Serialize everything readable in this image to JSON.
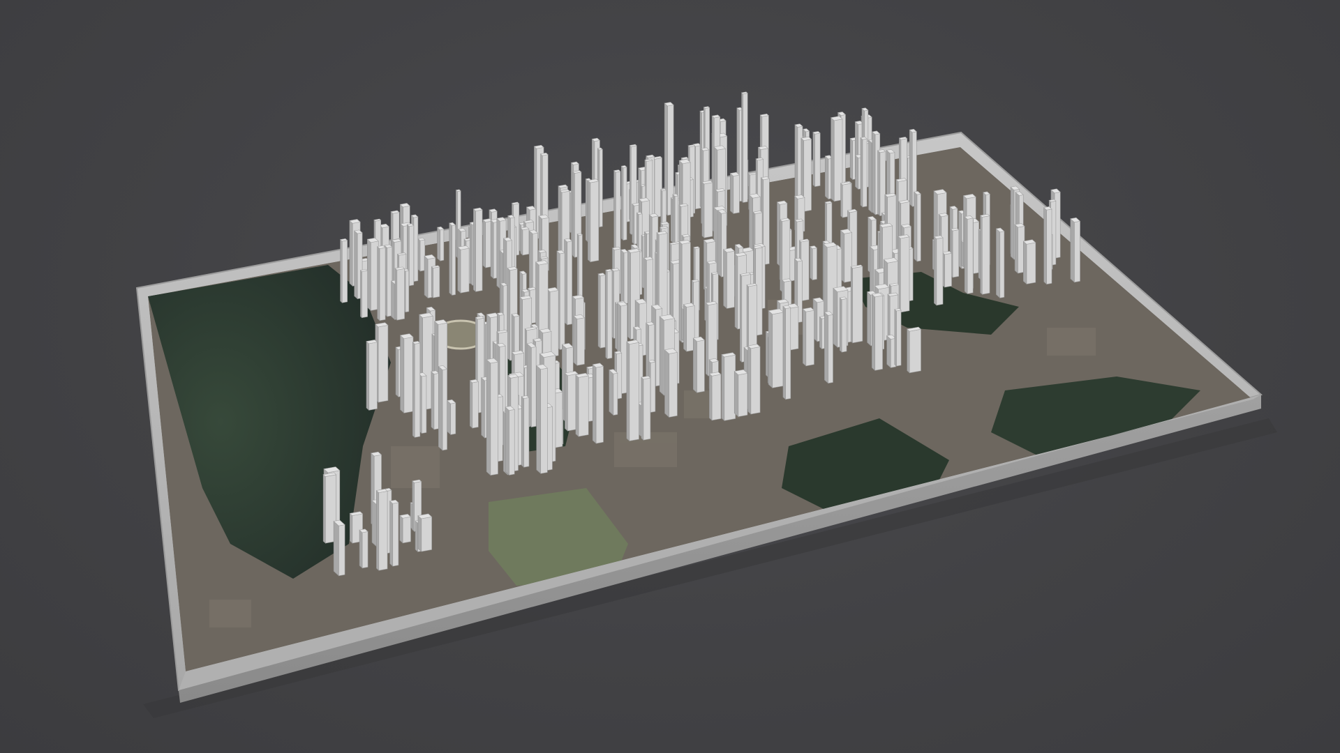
{
  "scene": {
    "subject": "3d-city-model-on-tray",
    "background_color": "#454548",
    "frame_color": "#b8b8b8",
    "frame_shadow_color": "#8d8d8d",
    "building_color": "#d6d6d6",
    "building_side_color": "#a9a9a9",
    "forest_color": "#2b3a2c",
    "urban_ground_color": "#6f6a62",
    "park_color": "#6c7a5a"
  }
}
